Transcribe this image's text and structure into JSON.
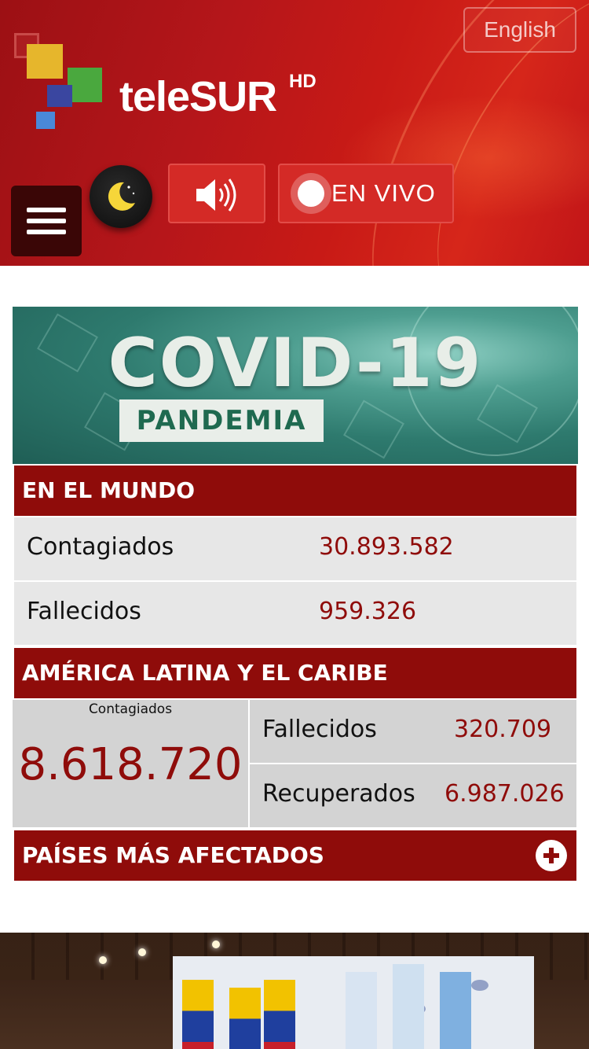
{
  "header": {
    "language_button": "English",
    "brand": "teleSUR",
    "brand_suffix": "HD",
    "live_label": "EN VIVO"
  },
  "banner": {
    "title": "COVID-19",
    "subtitle": "PANDEMIA"
  },
  "world": {
    "header": "EN EL MUNDO",
    "rows": [
      {
        "label": "Contagiados",
        "value": "30.893.582"
      },
      {
        "label": "Fallecidos",
        "value": "959.326"
      }
    ]
  },
  "latam": {
    "header": "AMÉRICA LATINA Y EL CARIBE",
    "infected_label": "Contagiados",
    "infected_value": "8.618.720",
    "deaths_label": "Fallecidos",
    "deaths_value": "320.709",
    "recovered_label": "Recuperados",
    "recovered_value": "6.987.026"
  },
  "countries": {
    "header": "PAÍSES MÁS AFECTADOS"
  },
  "colors": {
    "brand_red": "#c81a16",
    "section_red": "#8f0c0a"
  }
}
